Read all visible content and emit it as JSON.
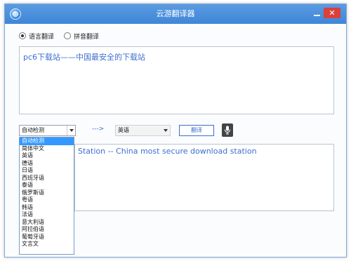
{
  "window": {
    "title": "云游翻译器",
    "close_glyph": "✕"
  },
  "mode": {
    "options": [
      {
        "label": "语言翻译",
        "checked": true
      },
      {
        "label": "拼音翻译",
        "checked": false
      }
    ]
  },
  "input": {
    "text": "pc6下载站——中国最安全的下载站"
  },
  "controls": {
    "source_language": "自动检测",
    "arrow": "--->",
    "target_language": "英语",
    "translate_label": "翻译"
  },
  "output": {
    "text": "Station -- China most secure download station"
  },
  "dropdown": {
    "selected_index": 0,
    "items": [
      "自动检测",
      "简体中文",
      "英语",
      "德语",
      "日语",
      "西班牙语",
      "泰语",
      "俄罗斯语",
      "粤语",
      "韩语",
      "法语",
      "意大利语",
      "阿拉伯语",
      "葡萄牙语",
      "文言文"
    ]
  },
  "colors": {
    "titlebar": "#4a90dc",
    "accent_text": "#3c6fce",
    "close_button": "#d9413a",
    "dropdown_selected": "#3399ff"
  },
  "icons": {
    "app": "cloud-globe-icon",
    "mic": "microphone-icon"
  }
}
